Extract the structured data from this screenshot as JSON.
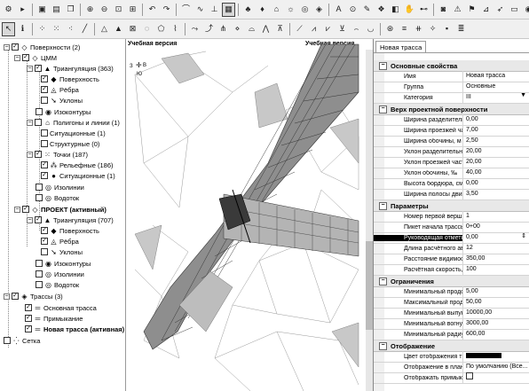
{
  "tree": {
    "items": [
      {
        "label": "Поверхности (2)"
      },
      {
        "label": "ЦММ"
      },
      {
        "label": "Триангуляция (363)"
      },
      {
        "label": "Поверхность"
      },
      {
        "label": "Рёбра"
      },
      {
        "label": "Уклоны"
      },
      {
        "label": "Изоконтуры"
      },
      {
        "label": "Полигоны и линии (1)"
      },
      {
        "label": "Ситуационные (1)"
      },
      {
        "label": "Структурные (0)"
      },
      {
        "label": "Точки (187)"
      },
      {
        "label": "Рельефные (186)"
      },
      {
        "label": "Ситуационные (1)"
      },
      {
        "label": "Изолинии"
      },
      {
        "label": "Водоток"
      },
      {
        "label": "ПРОЕКТ (активный)"
      },
      {
        "label": "Триангуляция (707)"
      },
      {
        "label": "Поверхность"
      },
      {
        "label": "Рёбра"
      },
      {
        "label": "Уклоны"
      },
      {
        "label": "Изоконтуры"
      },
      {
        "label": "Изолинии"
      },
      {
        "label": "Водоток"
      },
      {
        "label": "Трассы (3)"
      },
      {
        "label": "Основная трасса"
      },
      {
        "label": "Примыкание"
      },
      {
        "label": "Новая трасса (активная)"
      },
      {
        "label": "Сетка"
      }
    ]
  },
  "view": {
    "left_label": "Учебная версия",
    "right_label": "Учебная версия",
    "compass": {
      "n": "Ю",
      "w": "З",
      "e": "В"
    }
  },
  "props": {
    "tab": "Новая трасса",
    "sections": {
      "basic": "Основные свойства",
      "top": "Верх проектной поверхности",
      "params": "Параметры",
      "limits": "Ограничения",
      "display": "Отображение"
    },
    "rows": {
      "name": {
        "n": "Имя",
        "v": "Новая трасса"
      },
      "group": {
        "n": "Группа",
        "v": "Основные"
      },
      "category": {
        "n": "Категория",
        "v": "III"
      },
      "w_div": {
        "n": "Ширина разделительной",
        "v": "0,00"
      },
      "w_road": {
        "n": "Ширина проезжей части",
        "v": "7,00"
      },
      "w_shoulder": {
        "n": "Ширина обочины, м",
        "v": "2,50"
      },
      "s_div": {
        "n": "Уклон разделительной п",
        "v": "20,00"
      },
      "s_road": {
        "n": "Уклон проезжей части, ‰",
        "v": "20,00"
      },
      "s_shoulder": {
        "n": "Уклон обочины, ‰",
        "v": "40,00"
      },
      "curb": {
        "n": "Высота бордюра, см",
        "v": "0,00"
      },
      "lane": {
        "n": "Ширина полосы движени",
        "v": "3,50"
      },
      "first_vertex": {
        "n": "Номер первой вершины",
        "v": "1"
      },
      "start_pk": {
        "n": "Пикет начала трассы",
        "v": "0+00"
      },
      "ruling": {
        "n": "Руководящая отметка, м",
        "v": "0,00"
      },
      "car_len": {
        "n": "Длина расчётного автом",
        "v": "12"
      },
      "visibility": {
        "n": "Расстояние видимости, м",
        "v": "350,00"
      },
      "speed": {
        "n": "Расчётная скорость, км/ч",
        "v": "100"
      },
      "min_long": {
        "n": "Минимальный продольны",
        "v": "5,00"
      },
      "max_long": {
        "n": "Максимальный продольн",
        "v": "50,00"
      },
      "min_convex": {
        "n": "Минимальный выпуклый",
        "v": "10000,00"
      },
      "min_concave": {
        "n": "Минимальный вогнутый",
        "v": "3000,00"
      },
      "min_plan": {
        "n": "Минимальный радиус в п",
        "v": "600,00"
      },
      "route_color": {
        "n": "Цвет отображения трассы",
        "v": ""
      },
      "plan_display": {
        "n": "Отображение в плане",
        "v": "По умолчанию (Все..."
      },
      "show_junction": {
        "n": "Отображать примыкания",
        "v": ""
      }
    }
  }
}
